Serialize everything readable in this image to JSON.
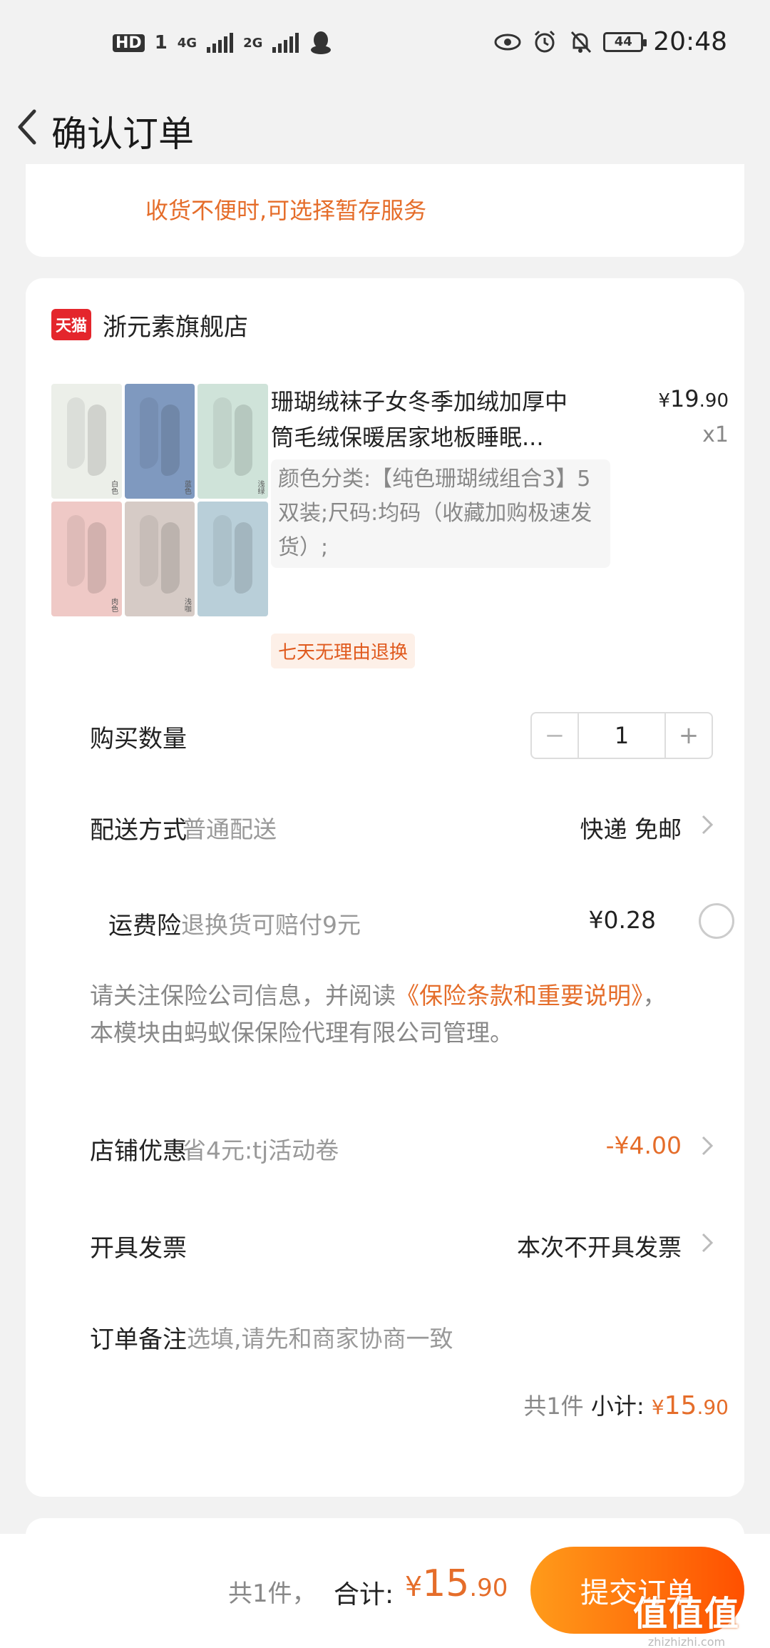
{
  "status_bar": {
    "hd": "HD",
    "sim1": "1",
    "net1": "4G",
    "net2": "2G",
    "battery": "44",
    "time": "20:48"
  },
  "header": {
    "title": "确认订单"
  },
  "notice": {
    "text": "收货不便时,可选择暂存服务"
  },
  "shop": {
    "badge": "天猫",
    "name": "浙元素旗舰店"
  },
  "product": {
    "title_line1": "珊瑚绒袜子女冬季加绒加厚中",
    "title_line2": "筒毛绒保暖居家地板睡眠...",
    "price_yen": "¥",
    "price_int": "19",
    "price_dec": ".90",
    "qty": "x1",
    "sku": "颜色分类:【纯色珊瑚绒组合3】5双装;尺码:均码（收藏加购极速发货）;",
    "return_tag": "七天无理由退换",
    "image_labels": [
      "白色",
      "蓝色",
      "浅绿",
      "肉色",
      "浅咖",
      ""
    ]
  },
  "quantity": {
    "label": "购买数量",
    "minus": "−",
    "value": "1",
    "plus": "+"
  },
  "delivery": {
    "label": "配送方式",
    "sub": "普通配送",
    "value": "快递 免邮"
  },
  "insurance": {
    "label": "运费险",
    "sub": "退换货可赔付9元",
    "value": "¥0.28",
    "note_pre": "请关注保险公司信息，并阅读",
    "note_link": "《保险条款和重要说明》",
    "note_post": "，本模块由蚂蚁保保险代理有限公司管理。"
  },
  "shop_discount": {
    "label": "店铺优惠",
    "sub": "省4元:tj活动卷",
    "value": "-¥4.00"
  },
  "invoice": {
    "label": "开具发票",
    "value": "本次不开具发票"
  },
  "remark": {
    "label": "订单备注",
    "placeholder": "选填,请先和商家协商一致"
  },
  "subtotal": {
    "count": "共1件",
    "label": "小计:",
    "yen": "¥",
    "int": "15",
    "dec": ".90"
  },
  "bottom": {
    "count": "共1件，",
    "total_label": "合计:",
    "yen": "¥",
    "int": "15",
    "dec": ".90",
    "submit": "提交订单"
  },
  "watermark": {
    "logo": "值值值",
    "site": "zhizhizhi.com"
  },
  "colors": {
    "accent": "#e56d2a",
    "brand_red": "#e4262c",
    "button_start": "#ff9b1a",
    "button_end": "#ff5000"
  }
}
